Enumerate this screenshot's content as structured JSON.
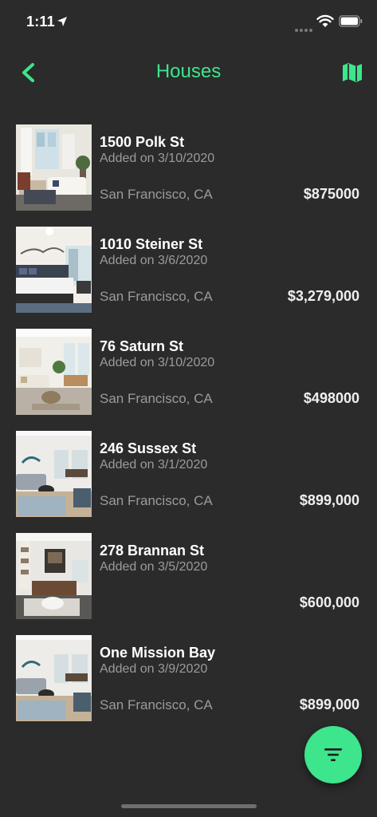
{
  "status_bar": {
    "time": "1:11"
  },
  "nav": {
    "title": "Houses",
    "accent_color": "#3de58c",
    "back_icon": "chevron-left-icon",
    "map_icon": "map-icon"
  },
  "listings": [
    {
      "address": "1500 Polk St",
      "added": "Added on 3/10/2020",
      "city": "San Francisco, CA",
      "price": "$875000"
    },
    {
      "address": "1010 Steiner St",
      "added": "Added on 3/6/2020",
      "city": "San Francisco, CA",
      "price": "$3,279,000"
    },
    {
      "address": "76 Saturn St",
      "added": "Added on 3/10/2020",
      "city": "San Francisco, CA",
      "price": "$498000"
    },
    {
      "address": "246 Sussex St",
      "added": "Added on 3/1/2020",
      "city": "San Francisco, CA",
      "price": "$899,000"
    },
    {
      "address": "278 Brannan St",
      "added": "Added on 3/5/2020",
      "city": "",
      "price": "$600,000"
    },
    {
      "address": "One Mission Bay",
      "added": "Added on 3/9/2020",
      "city": "San Francisco, CA",
      "price": "$899,000"
    }
  ],
  "fab": {
    "icon": "filter-icon"
  }
}
